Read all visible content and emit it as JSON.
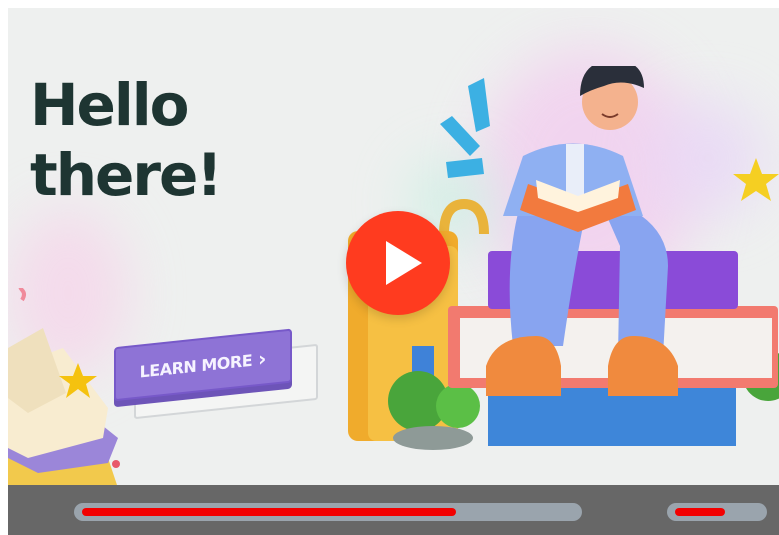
{
  "hero": {
    "greeting_line1": "Hello",
    "greeting_line2": "there!",
    "cta_label": "LEARN MORE"
  },
  "player": {
    "play_icon": "play-icon",
    "progress_fraction": 0.76,
    "volume_fraction": 0.6
  },
  "colors": {
    "heading": "#1e3532",
    "cta": "#8e73d6",
    "play": "#ff3b1f",
    "progress": "#f20000",
    "control_bar": "#676767"
  }
}
